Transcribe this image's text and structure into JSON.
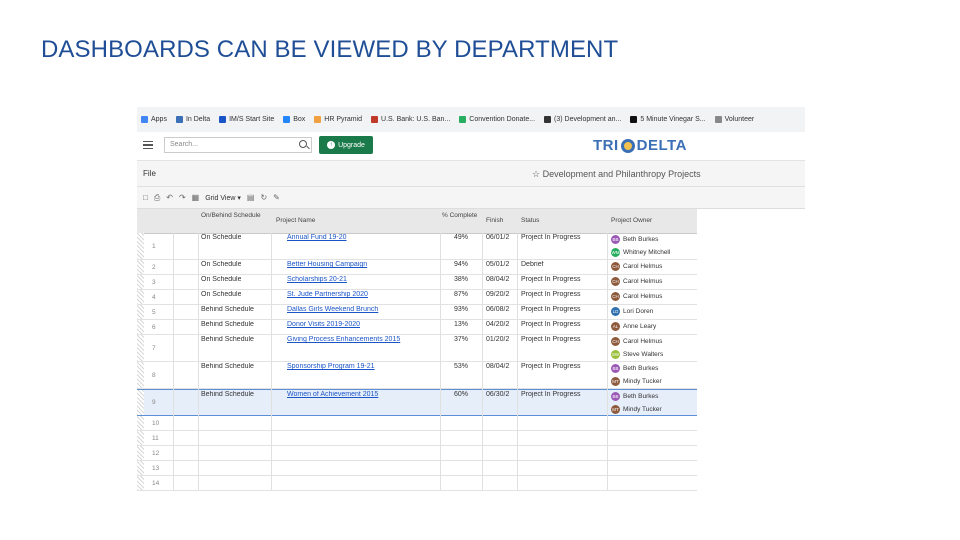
{
  "slide": {
    "title": "DASHBOARDS CAN BE VIEWED BY DEPARTMENT"
  },
  "bookmarks": [
    {
      "label": "Apps",
      "color": "#4285f4"
    },
    {
      "label": "In Delta",
      "color": "#3b6fb6"
    },
    {
      "label": "IM/S Start Site",
      "color": "#1a55c8"
    },
    {
      "label": "Box",
      "color": "#2486fc"
    },
    {
      "label": "HR Pyramid",
      "color": "#f1a142"
    },
    {
      "label": "U.S. Bank: U.S. Ban...",
      "color": "#c0392b"
    },
    {
      "label": "Convention Donate...",
      "color": "#27ae60"
    },
    {
      "label": "(3) Development an...",
      "color": "#333333"
    },
    {
      "label": "5 Minute Vinegar S...",
      "color": "#111111"
    },
    {
      "label": "Volunteer",
      "color": "#888888"
    }
  ],
  "header": {
    "search_placeholder": "Search...",
    "upgrade_label": "Upgrade",
    "logo_left": "TRI",
    "logo_right": "DELTA"
  },
  "file_menu": "File",
  "sheet_title": "Development and Philanthropy Projects",
  "toolbar": {
    "view_label": "Grid View"
  },
  "columns": {
    "status": "On/Behind Schedule",
    "project": "Project Name",
    "complete": "% Complete",
    "finish": "Finish",
    "status_col": "Status",
    "owner": "Project Owner"
  },
  "rows": [
    {
      "num": "1",
      "schedule": "On Schedule",
      "project": "Annual Fund 19-20",
      "pct": "49%",
      "finish": "06/01/2",
      "status": "Project In Progress",
      "owners": [
        {
          "name": "Beth Burkes",
          "initials": "BB",
          "color": "#9b59b6"
        },
        {
          "name": "Whitney Mitchell",
          "initials": "WM",
          "color": "#27ae60"
        }
      ]
    },
    {
      "num": "2",
      "schedule": "On Schedule",
      "project": "Better Housing Campaign",
      "pct": "94%",
      "finish": "05/01/2",
      "status": "Debrief",
      "owners": [
        {
          "name": "Carol Helmus",
          "initials": "CH",
          "color": "#8e5a3c"
        }
      ]
    },
    {
      "num": "3",
      "schedule": "On Schedule",
      "project": "Scholarships 20-21",
      "pct": "38%",
      "finish": "08/04/2",
      "status": "Project In Progress",
      "owners": [
        {
          "name": "Carol Helmus",
          "initials": "CH",
          "color": "#8e5a3c"
        }
      ]
    },
    {
      "num": "4",
      "schedule": "On Schedule",
      "project": "St. Jude Partnership 2020",
      "pct": "87%",
      "finish": "09/20/2",
      "status": "Project In Progress",
      "owners": [
        {
          "name": "Carol Helmus",
          "initials": "CH",
          "color": "#8e5a3c"
        }
      ]
    },
    {
      "num": "5",
      "schedule": "Behind Schedule",
      "project": "Dallas Girls Weekend Brunch",
      "pct": "93%",
      "finish": "06/08/2",
      "status": "Project In Progress",
      "owners": [
        {
          "name": "Lori Doren",
          "initials": "LD",
          "color": "#2e6fb0"
        }
      ]
    },
    {
      "num": "6",
      "schedule": "Behind Schedule",
      "project": "Donor Visits 2019-2020",
      "pct": "13%",
      "finish": "04/20/2",
      "status": "Project In Progress",
      "owners": [
        {
          "name": "Anne Leary",
          "initials": "AL",
          "color": "#8e5a3c"
        }
      ]
    },
    {
      "num": "7",
      "schedule": "Behind Schedule",
      "project": "Giving Process Enhancements 2015",
      "pct": "37%",
      "finish": "01/20/2",
      "status": "Project In Progress",
      "owners": [
        {
          "name": "Carol Helmus",
          "initials": "CH",
          "color": "#8e5a3c"
        },
        {
          "name": "Steve Walters",
          "initials": "SW",
          "color": "#9bbf3b"
        }
      ]
    },
    {
      "num": "8",
      "schedule": "Behind Schedule",
      "project": "Sponsorship Program 19-21",
      "pct": "53%",
      "finish": "08/04/2",
      "status": "Project In Progress",
      "owners": [
        {
          "name": "Beth Burkes",
          "initials": "BB",
          "color": "#9b59b6"
        },
        {
          "name": "Mindy Tucker",
          "initials": "MT",
          "color": "#8e5a3c"
        }
      ]
    },
    {
      "num": "9",
      "schedule": "Behind Schedule",
      "project": "Women of Achievement 2015",
      "pct": "60%",
      "finish": "06/30/2",
      "status": "Project In Progress",
      "owners": [
        {
          "name": "Beth Burkes",
          "initials": "BB",
          "color": "#9b59b6"
        },
        {
          "name": "Mindy Tucker",
          "initials": "MT",
          "color": "#8e5a3c"
        }
      ]
    }
  ],
  "empty_rows": [
    "10",
    "11",
    "12",
    "13",
    "14"
  ]
}
